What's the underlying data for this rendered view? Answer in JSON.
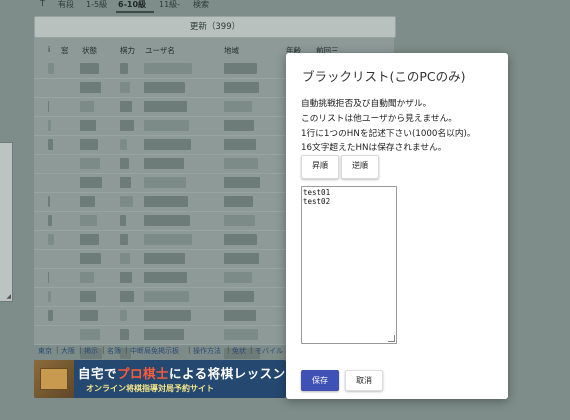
{
  "tabs": [
    "T",
    "有段",
    "1-5級",
    "6-10級",
    "11級-",
    "検索"
  ],
  "update_button": "更新（399）",
  "table": {
    "headers": [
      "i",
      "窓",
      "状態",
      "棋力",
      "ユーザ名",
      "地域",
      "年齢",
      "前回三"
    ]
  },
  "footer_links": [
    "東京",
    "大阪",
    "掲示",
    "名簿",
    "中断局免掲示板",
    "操作方法",
    "免状",
    "モバイル"
  ],
  "banner": {
    "title_pre": "自宅で",
    "title_accent": "プロ棋士",
    "title_post": "による将棋レッスン",
    "subtitle": "オンライン将棋指導対局予約サイト"
  },
  "modal": {
    "title": "ブラックリスト(このPCのみ)",
    "description": [
      "自動挑戦拒否及び自動聞かザル。",
      "このリストは他ユーザから見えません。",
      "1行に1つのHNを記述下さい(1000名以内)。",
      "16文字超えたHNは保存されません。"
    ],
    "sort_asc_label": "昇順",
    "sort_desc_label": "逆順",
    "list_entries": [
      "test01",
      "test02"
    ],
    "save_label": "保存",
    "cancel_label": "取消"
  },
  "colors": {
    "overlay": "#7e8d89",
    "primary_button": "#3f51b5"
  }
}
